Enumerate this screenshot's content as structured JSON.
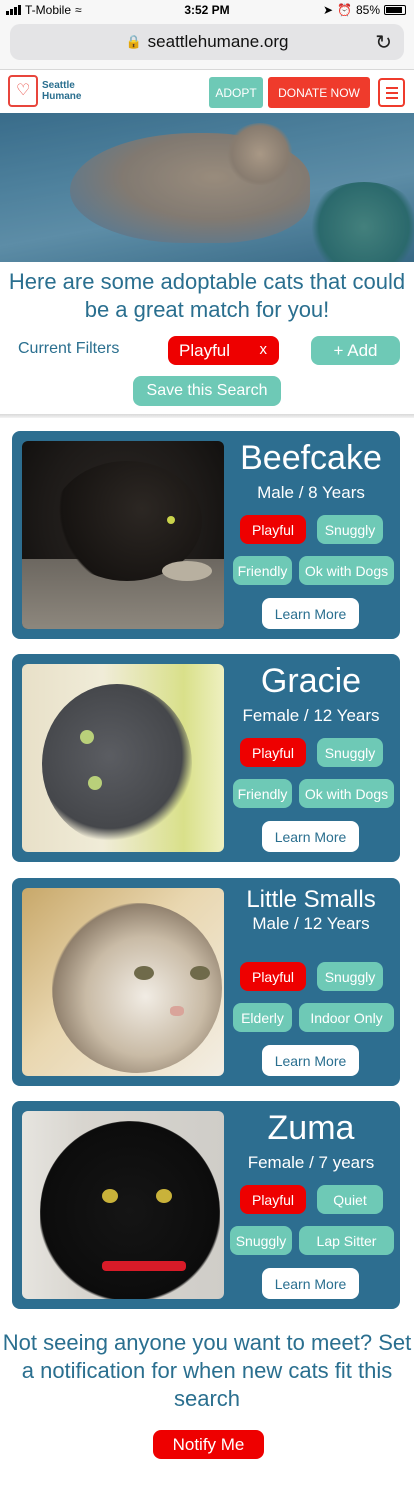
{
  "status_bar": {
    "carrier": "T-Mobile",
    "time": "3:52 PM",
    "battery": "85%",
    "icons": [
      "signal-icon",
      "wifi-icon",
      "location-icon",
      "alarm-icon",
      "battery-icon"
    ]
  },
  "browser": {
    "url": "seattlehumane.org",
    "icons": [
      "lock-icon",
      "reload-icon"
    ]
  },
  "header": {
    "logo_line1": "Seattle",
    "logo_line2": "Humane",
    "adopt_label": "ADOPT",
    "donate_label": "DONATE NOW",
    "menu_icon": "hamburger-icon"
  },
  "intro": {
    "title": "Here are some adoptable cats that could be a great match for you!",
    "filters_label": "Current Filters",
    "active_filter": "Playful",
    "remove_filter": "x",
    "add_label": "+ Add",
    "save_label": "Save this Search"
  },
  "cats": [
    {
      "name": "Beefcake",
      "meta": "Male / 8 Years",
      "tags": [
        "Playful",
        "Snuggly",
        "Friendly",
        "Ok with Dogs"
      ],
      "learn": "Learn More"
    },
    {
      "name": "Gracie",
      "meta": "Female / 12 Years",
      "tags": [
        "Playful",
        "Snuggly",
        "Friendly",
        "Ok with Dogs"
      ],
      "learn": "Learn More"
    },
    {
      "name": "Little Smalls",
      "meta": "Male / 12 Years",
      "tags": [
        "Playful",
        "Snuggly",
        "Elderly",
        "Indoor Only"
      ],
      "learn": "Learn More"
    },
    {
      "name": "Zuma",
      "meta": "Female / 7 years",
      "tags": [
        "Playful",
        "Quiet",
        "Snuggly",
        "Lap Sitter"
      ],
      "learn": "Learn More"
    }
  ],
  "footer": {
    "prompt": "Not seeing anyone you want to meet? Set a notification for when new cats fit this search",
    "notify_label": "Notify Me"
  },
  "colors": {
    "brand_teal": "#2d6e90",
    "accent_mint": "#6ec9b6",
    "accent_red": "#ee0000"
  }
}
